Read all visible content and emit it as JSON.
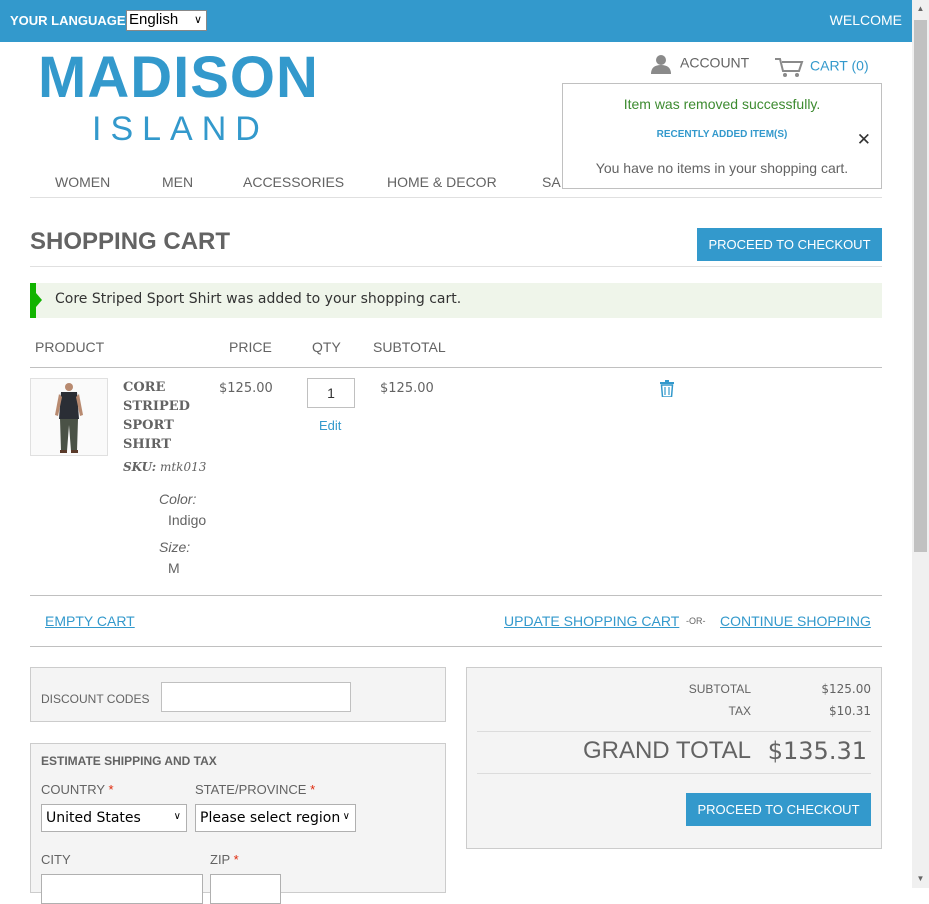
{
  "topbar": {
    "language_label": "YOUR LANGUAGE:",
    "language_value": "English",
    "welcome": "WELCOME",
    "bg_color": "#3399cc"
  },
  "logo": {
    "main": "MADISON",
    "sub": "ISLAND"
  },
  "header": {
    "account_label": "ACCOUNT",
    "account_icon": "user-icon",
    "cart_label": "CART",
    "cart_count": "(0)",
    "cart_icon": "cart-icon"
  },
  "nav": {
    "items": [
      "WOMEN",
      "MEN",
      "ACCESSORIES",
      "HOME & DECOR",
      "SA"
    ]
  },
  "minicart": {
    "success": "Item was removed successfully.",
    "recent_label": "RECENTLY ADDED ITEM(S)",
    "close": "✕",
    "empty_text": "You have no items in your shopping cart."
  },
  "page": {
    "title": "SHOPPING CART",
    "checkout_button": "PROCEED TO CHECKOUT",
    "success_message": "Core Striped Sport Shirt was added to your shopping cart."
  },
  "table": {
    "headers": [
      "PRODUCT",
      "PRICE",
      "QTY",
      "SUBTOTAL"
    ],
    "item": {
      "name_lines": [
        "CORE",
        "STRIPED",
        "SPORT",
        "SHIRT"
      ],
      "sku_label": "SKU:",
      "sku": "mtk013",
      "color_label": "Color:",
      "color_value": "Indigo",
      "size_label": "Size:",
      "size_value": "M",
      "price": "$125.00",
      "qty": "1",
      "edit": "Edit",
      "subtotal": "$125.00",
      "remove_icon": "trash-icon"
    }
  },
  "actions": {
    "empty_cart": "EMPTY CART",
    "update_cart": "UPDATE SHOPPING CART",
    "or": "-OR-",
    "continue": "CONTINUE SHOPPING"
  },
  "discount": {
    "label": "DISCOUNT CODES",
    "value": ""
  },
  "shipping": {
    "title": "ESTIMATE SHIPPING AND TAX",
    "country_label": "COUNTRY",
    "country_value": "United States",
    "state_label": "STATE/PROVINCE",
    "state_value": "Please select region",
    "city_label": "CITY",
    "zip_label": "ZIP",
    "required_mark": "*"
  },
  "totals": {
    "subtotal_label": "SUBTOTAL",
    "subtotal_value": "$125.00",
    "tax_label": "TAX",
    "tax_value": "$10.31",
    "grand_label": "GRAND TOTAL",
    "grand_value": "$135.31",
    "checkout_button": "PROCEED TO CHECKOUT"
  }
}
